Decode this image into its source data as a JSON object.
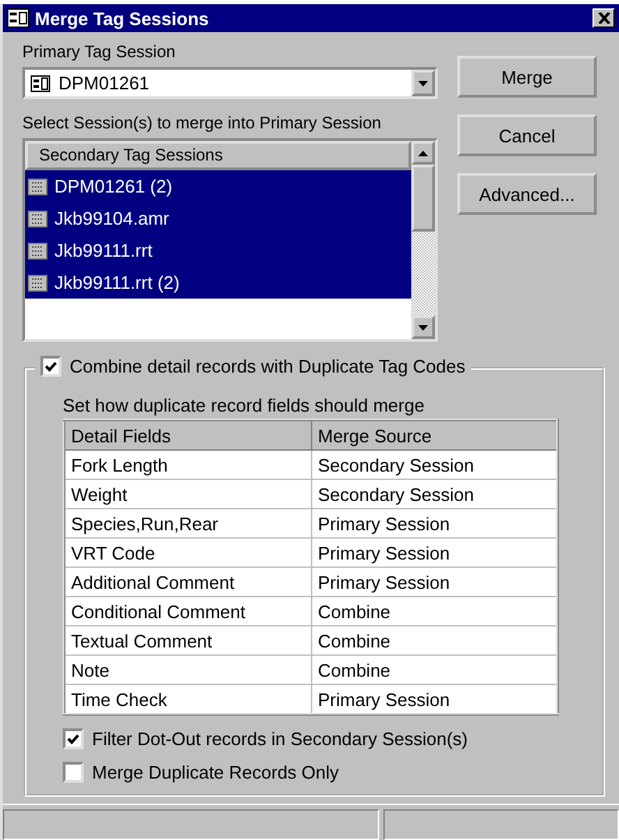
{
  "window": {
    "title": "Merge Tag Sessions"
  },
  "primary": {
    "label": "Primary Tag Session",
    "value": "DPM01261"
  },
  "secondary": {
    "label": "Select Session(s) to merge into Primary Session",
    "column": "Secondary Tag Sessions",
    "items": [
      {
        "name": "DPM01261 (2)",
        "selected": true
      },
      {
        "name": "Jkb99104.amr",
        "selected": true
      },
      {
        "name": "Jkb99111.rrt",
        "selected": true
      },
      {
        "name": "Jkb99111.rrt (2)",
        "selected": true
      }
    ]
  },
  "buttons": [
    "Merge",
    "Cancel",
    "Advanced..."
  ],
  "combine": {
    "label": "Combine detail records with Duplicate Tag Codes",
    "checked": true,
    "hint": "Set how duplicate record fields should merge",
    "columns": [
      "Detail Fields",
      "Merge Source"
    ],
    "rows": [
      [
        "Fork Length",
        "Secondary Session"
      ],
      [
        "Weight",
        "Secondary Session"
      ],
      [
        "Species,Run,Rear",
        "Primary Session"
      ],
      [
        "VRT Code",
        "Primary Session"
      ],
      [
        "Additional Comment",
        "Primary Session"
      ],
      [
        "Conditional Comment",
        "Combine"
      ],
      [
        "Textual Comment",
        "Combine"
      ],
      [
        "Note",
        "Combine"
      ],
      [
        "Time Check",
        "Primary Session"
      ]
    ],
    "options": [
      {
        "label": "Filter Dot-Out records in Secondary Session(s)",
        "checked": true
      },
      {
        "label": "Merge Duplicate Records Only",
        "checked": false
      }
    ]
  }
}
